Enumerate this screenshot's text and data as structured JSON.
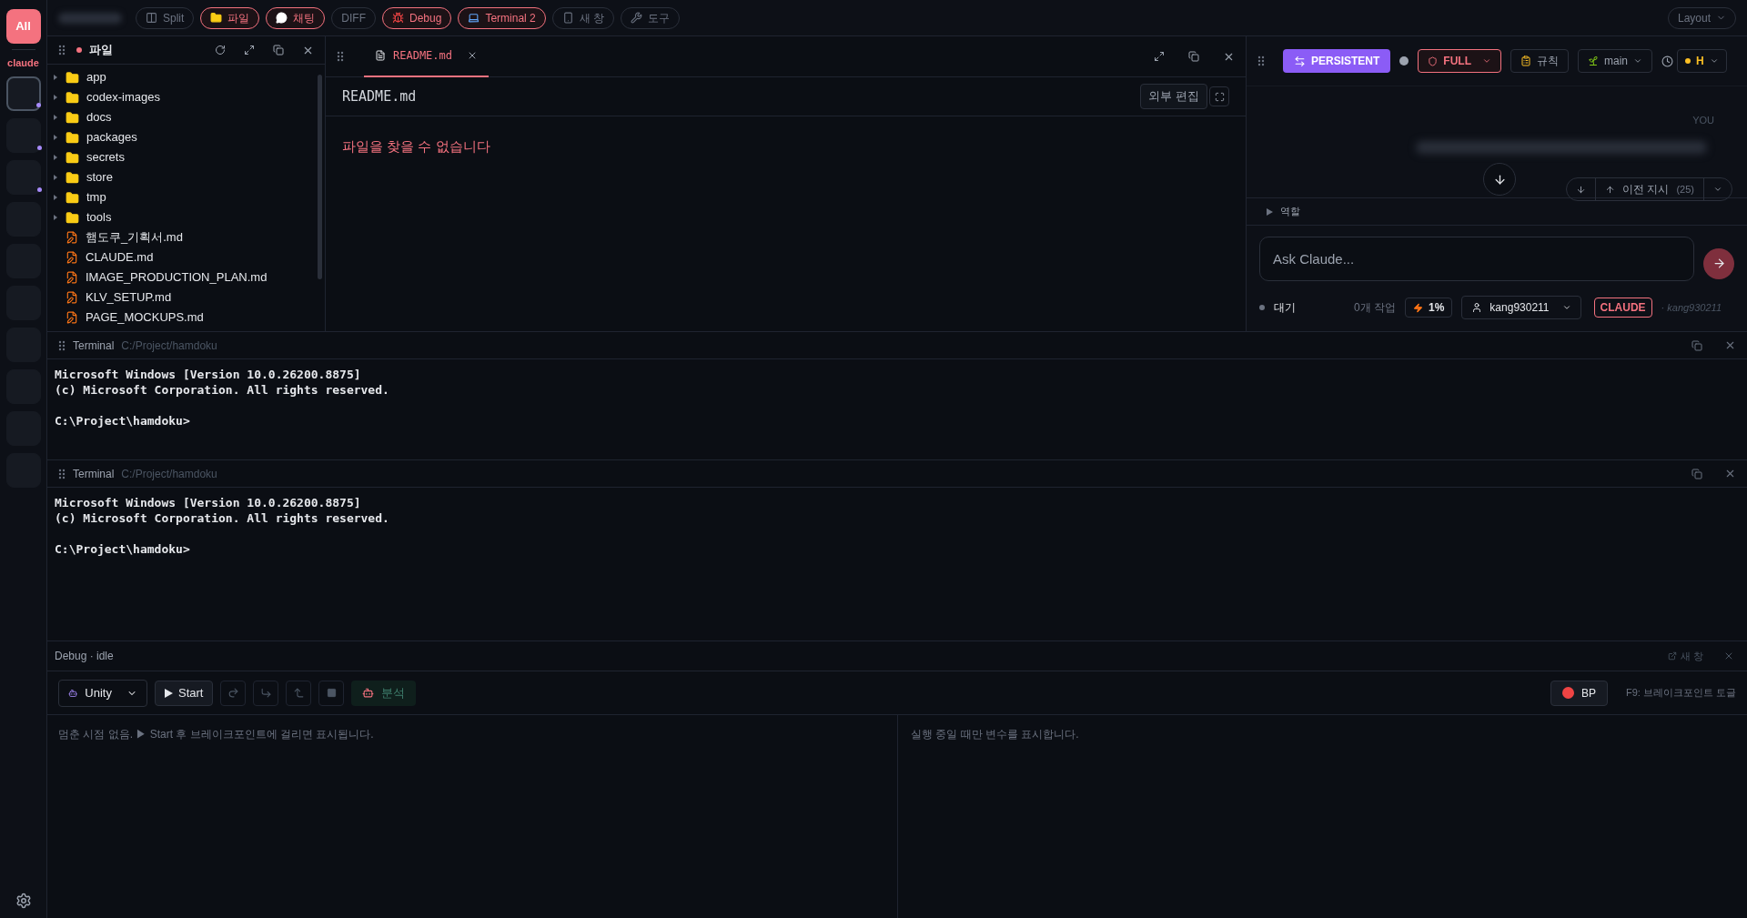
{
  "rail": {
    "all_label": "All",
    "workspace_label": "claude",
    "sessions": [
      {
        "selected": true,
        "unread": true
      },
      {
        "selected": false,
        "unread": true
      },
      {
        "selected": false,
        "unread": true
      },
      {
        "selected": false,
        "unread": false
      },
      {
        "selected": false,
        "unread": false
      },
      {
        "selected": false,
        "unread": false
      },
      {
        "selected": false,
        "unread": false
      },
      {
        "selected": false,
        "unread": false
      },
      {
        "selected": false,
        "unread": false
      },
      {
        "selected": false,
        "unread": false
      }
    ]
  },
  "toolbar": {
    "buttons": [
      {
        "label": "Split",
        "kind": "split",
        "active": false
      },
      {
        "label": "파일",
        "kind": "folder",
        "active": true
      },
      {
        "label": "채팅",
        "kind": "chat",
        "active": true
      },
      {
        "label": "DIFF",
        "kind": "plain",
        "active": false
      },
      {
        "label": "Debug",
        "kind": "bug",
        "active": true
      },
      {
        "label": "Terminal 2",
        "kind": "laptop",
        "active": true
      },
      {
        "label": "새 창",
        "kind": "phone",
        "active": false
      },
      {
        "label": "도구",
        "kind": "wrench",
        "active": false
      }
    ],
    "layout": "Layout"
  },
  "file_panel": {
    "title": "파일",
    "items": [
      {
        "name": "app",
        "kind": "folder"
      },
      {
        "name": "codex-images",
        "kind": "folder"
      },
      {
        "name": "docs",
        "kind": "folder"
      },
      {
        "name": "packages",
        "kind": "folder"
      },
      {
        "name": "secrets",
        "kind": "folder"
      },
      {
        "name": "store",
        "kind": "folder"
      },
      {
        "name": "tmp",
        "kind": "folder"
      },
      {
        "name": "tools",
        "kind": "folder"
      },
      {
        "name": "햄도쿠_기획서.md",
        "kind": "file"
      },
      {
        "name": "CLAUDE.md",
        "kind": "file"
      },
      {
        "name": "IMAGE_PRODUCTION_PLAN.md",
        "kind": "file"
      },
      {
        "name": "KLV_SETUP.md",
        "kind": "file"
      },
      {
        "name": "PAGE_MOCKUPS.md",
        "kind": "file"
      }
    ]
  },
  "editor": {
    "tab": "README.md",
    "heading": "README.md",
    "external_button": "외부 편집",
    "error": "파일을 찾을 수 없습니다"
  },
  "chat": {
    "mode": "PERSISTENT",
    "permission": "FULL",
    "rules": "규칙",
    "branch": "main",
    "model": "H",
    "sender": "YOU",
    "history_button": "이전 지시",
    "history_count": "(25)",
    "role_toggle": "역할",
    "input": {
      "placeholder": "Ask Claude..."
    },
    "status": "대기",
    "tasks": "0개 작업",
    "usage": "1%",
    "user": "kang930211",
    "agent_badge": "CLAUDE",
    "agent_user": "· kang930211"
  },
  "terminals": [
    {
      "title": "Terminal",
      "path": "C:/Project/hamdoku",
      "lines": [
        "Microsoft Windows [Version 10.0.26200.8875]",
        "(c) Microsoft Corporation. All rights reserved."
      ],
      "prompt": "C:\\Project\\hamdoku>"
    },
    {
      "title": "Terminal",
      "path": "C:/Project/hamdoku",
      "lines": [
        "Microsoft Windows [Version 10.0.26200.8875]",
        "(c) Microsoft Corporation. All rights reserved."
      ],
      "prompt": "C:\\Project\\hamdoku>"
    }
  ],
  "debug": {
    "title": "Debug · idle",
    "new_window": "새 창",
    "target": "Unity",
    "start": "Start",
    "steps": [
      {
        "kind": "over",
        "disabled": true
      },
      {
        "kind": "into",
        "disabled": true
      },
      {
        "kind": "out",
        "disabled": true
      },
      {
        "kind": "stop",
        "disabled": true
      }
    ],
    "analyze": "분석",
    "bp": "BP",
    "bp_hint": "F9: 브레이크포인트 토글",
    "stack_empty": "멈춘 시점 없음. ▶ Start 후 브레이크포인트에 걸리면 표시됩니다.",
    "vars_empty": "실행 중일 때만 변수를 표시합니다."
  }
}
